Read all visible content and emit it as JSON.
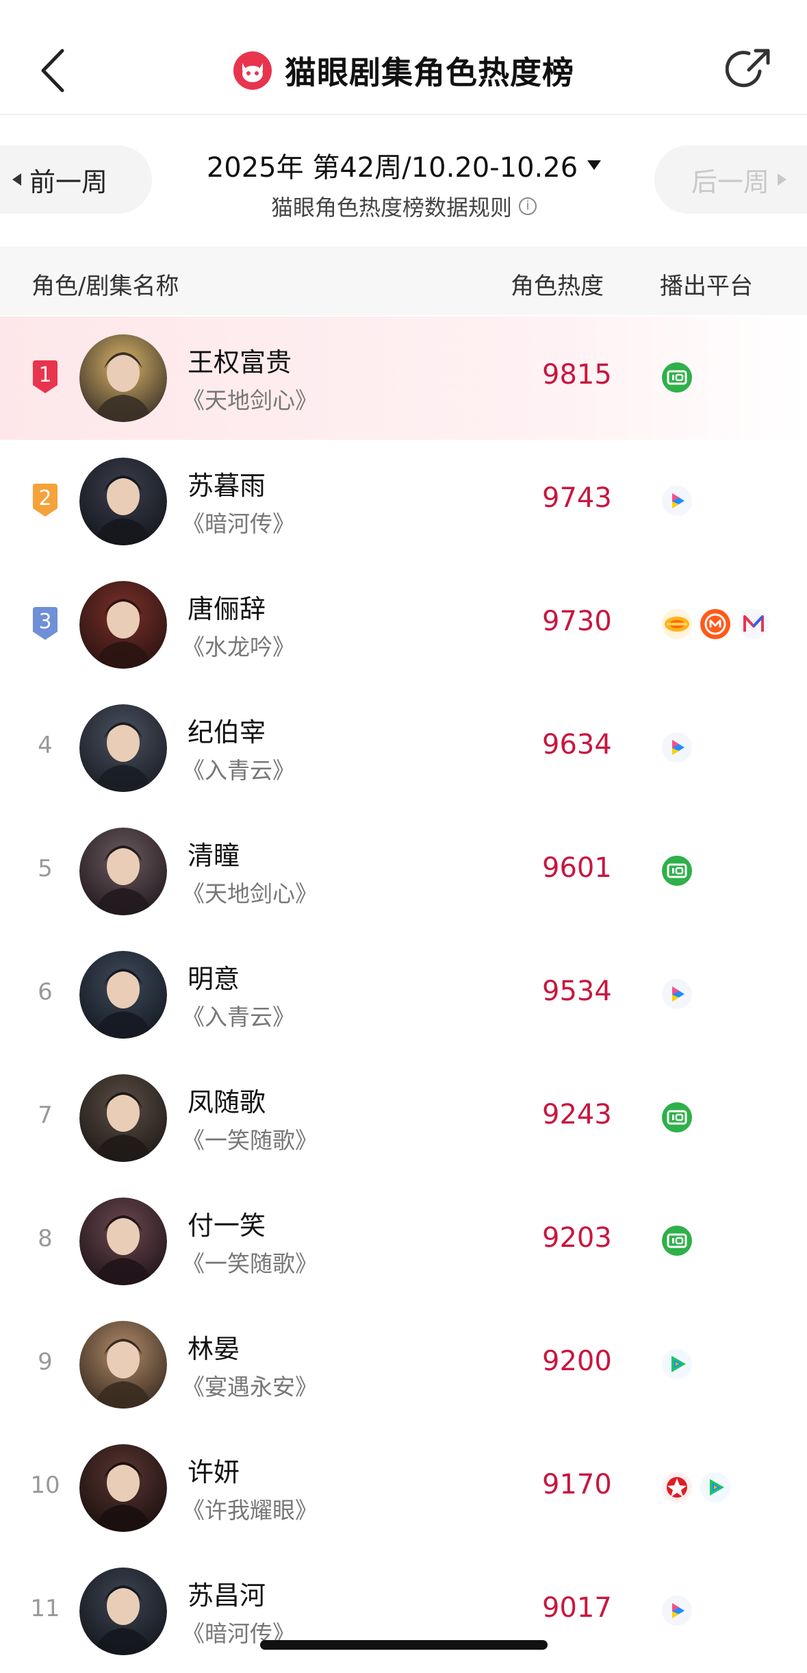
{
  "header": {
    "title": "猫眼剧集角色热度榜"
  },
  "week_nav": {
    "prev_label": "前一周",
    "next_label": "后一周",
    "week_text": "2025年  第42周/10.20-10.26",
    "rules_text": "猫眼角色热度榜数据规则",
    "info_glyph": "i"
  },
  "table": {
    "col_name": "角色/剧集名称",
    "col_heat": "角色热度",
    "col_platform": "播出平台"
  },
  "rows": [
    {
      "rank": "1",
      "name": "王权富贵",
      "show": "《天地剑心》",
      "heat": "9815",
      "platforms": [
        "iqiyi"
      ]
    },
    {
      "rank": "2",
      "name": "苏暮雨",
      "show": "《暗河传》",
      "heat": "9743",
      "platforms": [
        "youku"
      ]
    },
    {
      "rank": "3",
      "name": "唐俪辞",
      "show": "《水龙吟》",
      "heat": "9730",
      "platforms": [
        "tencent",
        "mgtv",
        "migu"
      ]
    },
    {
      "rank": "4",
      "name": "纪伯宰",
      "show": "《入青云》",
      "heat": "9634",
      "platforms": [
        "youku"
      ]
    },
    {
      "rank": "5",
      "name": "清瞳",
      "show": "《天地剑心》",
      "heat": "9601",
      "platforms": [
        "iqiyi"
      ]
    },
    {
      "rank": "6",
      "name": "明意",
      "show": "《入青云》",
      "heat": "9534",
      "platforms": [
        "youku"
      ]
    },
    {
      "rank": "7",
      "name": "凤随歌",
      "show": "《一笑随歌》",
      "heat": "9243",
      "platforms": [
        "iqiyi"
      ]
    },
    {
      "rank": "8",
      "name": "付一笑",
      "show": "《一笑随歌》",
      "heat": "9203",
      "platforms": [
        "iqiyi"
      ]
    },
    {
      "rank": "9",
      "name": "林晏",
      "show": "《宴遇永安》",
      "heat": "9200",
      "platforms": [
        "tencent-video"
      ]
    },
    {
      "rank": "10",
      "name": "许妍",
      "show": "《许我耀眼》",
      "heat": "9170",
      "platforms": [
        "cctv",
        "tencent-video"
      ]
    },
    {
      "rank": "11",
      "name": "苏昌河",
      "show": "《暗河传》",
      "heat": "9017",
      "platforms": [
        "youku"
      ]
    }
  ],
  "colors": {
    "accent": "#c8163f",
    "rank1": "#e8354d",
    "rank2": "#f5a23a",
    "rank3": "#6f8fd6"
  }
}
